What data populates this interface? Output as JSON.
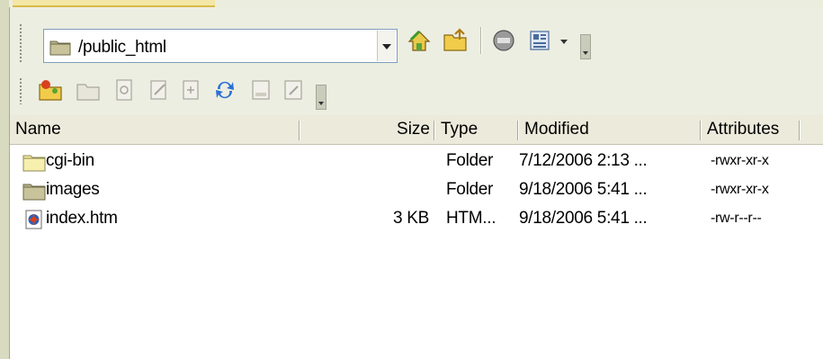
{
  "toolbar": {
    "path_value": "/public_html",
    "icons_row1": [
      "home-icon",
      "folder-up-icon",
      "disconnect-icon",
      "view-options-icon"
    ],
    "icons_row2": [
      "new-folder-icon",
      "open-folder-icon",
      "view-file-icon",
      "edit-file-icon",
      "properties-icon",
      "refresh-icon",
      "upload-icon",
      "download-icon"
    ]
  },
  "columns": {
    "name": "Name",
    "size": "Size",
    "type": "Type",
    "modified": "Modified",
    "attributes": "Attributes"
  },
  "files": [
    {
      "name": "cgi-bin",
      "size": "",
      "type": "Folder",
      "modified": "7/12/2006 2:13 ...",
      "attributes": "-rwxr-xr-x",
      "icon": "folder-icon"
    },
    {
      "name": "images",
      "size": "",
      "type": "Folder",
      "modified": "9/18/2006 5:41 ...",
      "attributes": "-rwxr-xr-x",
      "icon": "folder-icon"
    },
    {
      "name": "index.htm",
      "size": "3 KB",
      "type": "HTM...",
      "modified": "9/18/2006 5:41 ...",
      "attributes": "-rw-r--r--",
      "icon": "html-file-icon"
    }
  ],
  "colors": {
    "toolbar_bg": "#eceee2",
    "folder_yellow": "#f2e27a",
    "header_bg": "#ebeadb"
  }
}
